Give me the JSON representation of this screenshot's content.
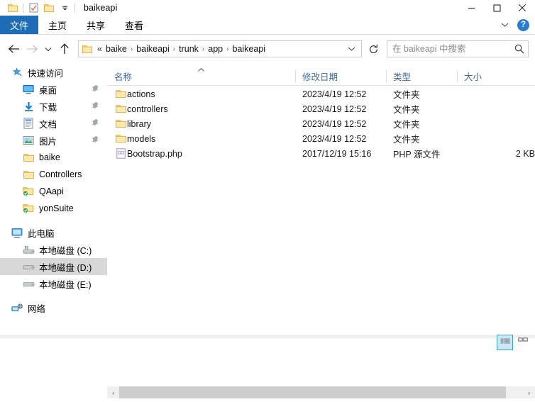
{
  "window": {
    "title": "baikeapi",
    "quick_access": [
      {
        "name": "folder-icon",
        "label": "文件夹"
      },
      {
        "name": "properties-icon",
        "label": "属性"
      },
      {
        "name": "new-folder-icon",
        "label": "新建文件夹"
      },
      {
        "name": "customize-chevron-icon",
        "label": "自定义快速访问工具栏"
      }
    ],
    "controls": {
      "minimize": "─",
      "maximize": "□",
      "close": "✕"
    }
  },
  "ribbon": {
    "tabs": [
      {
        "label": "文件",
        "active": true
      },
      {
        "label": "主页",
        "active": false
      },
      {
        "label": "共享",
        "active": false
      },
      {
        "label": "查看",
        "active": false
      }
    ],
    "expand_label": "展开功能区",
    "help_label": "?"
  },
  "address": {
    "back_label": "后退",
    "forward_label": "前进",
    "recent_label": "最近浏览的位置",
    "up_label": "向上",
    "ellipsis": "«",
    "crumbs": [
      "baike",
      "baikeapi",
      "trunk",
      "app",
      "baikeapi"
    ],
    "separator": "›",
    "refresh_label": "刷新"
  },
  "search": {
    "placeholder": "在 baikeapi 中搜索",
    "value": ""
  },
  "sidebar": {
    "groups": [
      {
        "header": {
          "label": "快速访问",
          "icon": "quick-access-star-icon"
        },
        "items": [
          {
            "label": "桌面",
            "icon": "desktop-icon",
            "pinned": true,
            "selected": false
          },
          {
            "label": "下载",
            "icon": "downloads-icon",
            "pinned": true,
            "selected": false
          },
          {
            "label": "文档",
            "icon": "documents-icon",
            "pinned": true,
            "selected": false
          },
          {
            "label": "图片",
            "icon": "pictures-icon",
            "pinned": true,
            "selected": false
          },
          {
            "label": "baike",
            "icon": "folder-icon",
            "pinned": false,
            "selected": false
          },
          {
            "label": "Controllers",
            "icon": "folder-icon",
            "pinned": false,
            "selected": false
          },
          {
            "label": "QAapi",
            "icon": "synced-folder-icon",
            "pinned": false,
            "selected": false
          },
          {
            "label": "yonSuite",
            "icon": "synced-folder-icon",
            "pinned": false,
            "selected": false
          }
        ]
      },
      {
        "header": {
          "label": "此电脑",
          "icon": "this-pc-icon"
        },
        "items": [
          {
            "label": "本地磁盘 (C:)",
            "icon": "system-drive-icon",
            "pinned": false,
            "selected": false
          },
          {
            "label": "本地磁盘 (D:)",
            "icon": "drive-icon",
            "pinned": false,
            "selected": true
          },
          {
            "label": "本地磁盘 (E:)",
            "icon": "drive-icon",
            "pinned": false,
            "selected": false
          }
        ]
      },
      {
        "header": {
          "label": "网络",
          "icon": "network-icon"
        },
        "items": []
      }
    ]
  },
  "file_list": {
    "columns": [
      {
        "label": "名称",
        "sorted": "asc"
      },
      {
        "label": "修改日期",
        "sorted": null
      },
      {
        "label": "类型",
        "sorted": null
      },
      {
        "label": "大小",
        "sorted": null
      }
    ],
    "rows": [
      {
        "name": "actions",
        "date": "2023/4/19 12:52",
        "type": "文件夹",
        "size": "",
        "icon": "folder-icon"
      },
      {
        "name": "controllers",
        "date": "2023/4/19 12:52",
        "type": "文件夹",
        "size": "",
        "icon": "folder-icon"
      },
      {
        "name": "library",
        "date": "2023/4/19 12:52",
        "type": "文件夹",
        "size": "",
        "icon": "folder-icon"
      },
      {
        "name": "models",
        "date": "2023/4/19 12:52",
        "type": "文件夹",
        "size": "",
        "icon": "folder-icon"
      },
      {
        "name": "Bootstrap.php",
        "date": "2017/12/19 15:16",
        "type": "PHP 源文件",
        "size": "2 KB",
        "icon": "php-file-icon"
      }
    ]
  },
  "scrollbar": {
    "left_arrow": "‹",
    "right_arrow": "›"
  },
  "view_buttons": [
    {
      "name": "details-view-button",
      "active": true
    },
    {
      "name": "large-icons-view-button",
      "active": false
    }
  ],
  "colors": {
    "accent": "#1e6cb5",
    "folder": "#ffd071",
    "header_text": "#41699a",
    "selection": "#d8d8d8",
    "scroll_thumb": "#cdcdcd"
  }
}
